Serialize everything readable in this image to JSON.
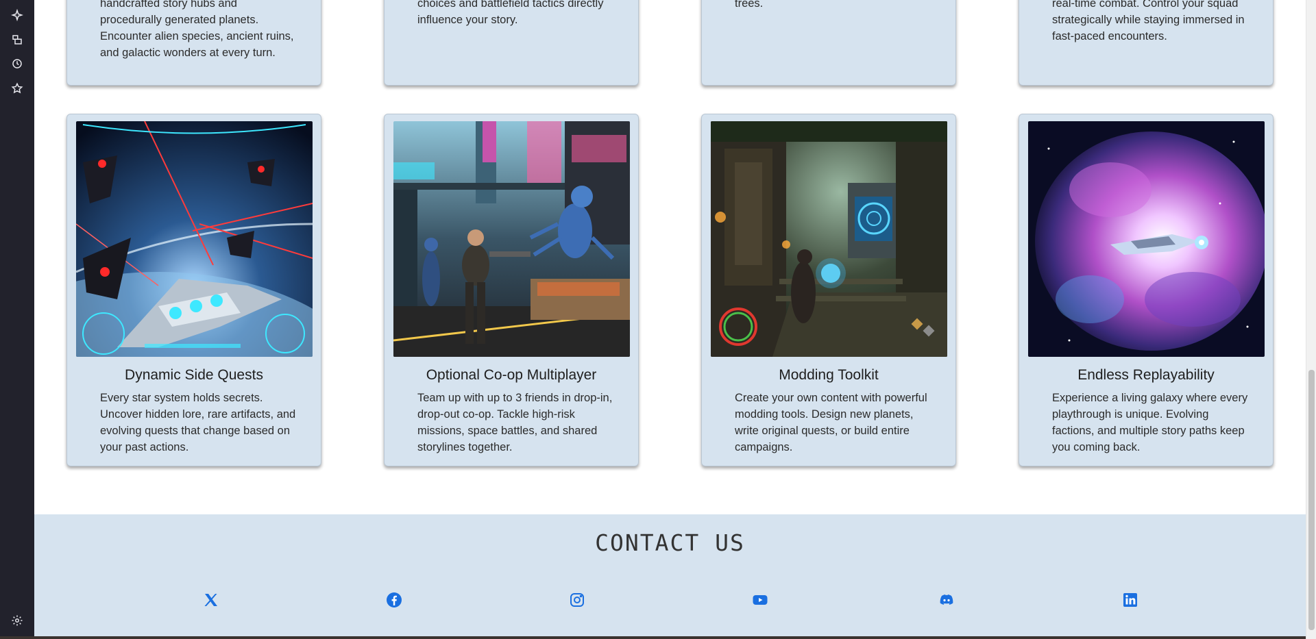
{
  "rail": {
    "icons": [
      "sparkle-icon",
      "layers-icon",
      "history-icon",
      "star-icon",
      "gear-icon"
    ]
  },
  "top_cards": [
    {
      "desc": "handcrafted story hubs and procedurally generated planets. Encounter alien species, ancient ruins, and galactic wonders at every turn."
    },
    {
      "desc": "choices and battlefield tactics directly influence your story."
    },
    {
      "desc": "trees."
    },
    {
      "desc": "real-time combat. Control your squad strategically while staying immersed in fast-paced encounters."
    }
  ],
  "cards": [
    {
      "title": "Dynamic Side Quests",
      "desc": "Every star system holds secrets. Uncover hidden lore, rare artifacts, and evolving quests that change based on your past actions."
    },
    {
      "title": "Optional Co-op Multiplayer",
      "desc": "Team up with up to 3 friends in drop-in, drop-out co-op. Tackle high-risk missions, space battles, and shared storylines together."
    },
    {
      "title": "Modding Toolkit",
      "desc": "Create your own content with powerful modding tools. Design new planets, write original quests, or build entire campaigns."
    },
    {
      "title": "Endless Replayability",
      "desc": "Experience a living galaxy where every playthrough is unique. Evolving factions, and multiple story paths keep you coming back."
    }
  ],
  "contact": {
    "title": "CONTACT US",
    "socials": [
      "x-icon",
      "facebook-icon",
      "instagram-icon",
      "youtube-icon",
      "discord-icon",
      "linkedin-icon"
    ]
  },
  "colors": {
    "card_bg": "#d6e3ef",
    "rail_bg": "#22222c",
    "social_blue": "#1a6fe0"
  }
}
